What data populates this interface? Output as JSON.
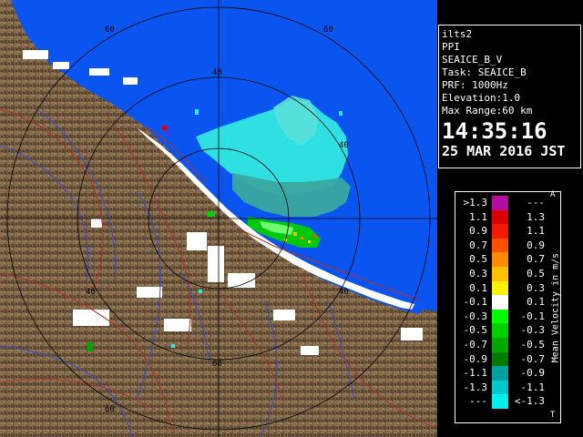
{
  "info": {
    "site": "ilts2",
    "mode": "PPI",
    "product": "SEAICE_B_V",
    "task": "Task: SEAICE_B",
    "prf": "PRF: 1000Hz",
    "elevation": "Elevation:1.0",
    "max_range": "Max Range:60 km",
    "time": "14:35:16",
    "date": "25 MAR 2016 JST"
  },
  "rings": {
    "labels": [
      "60",
      "40",
      "40",
      "40",
      "40",
      "60",
      "60",
      "60"
    ]
  },
  "legend": {
    "title": "Mean Velocity in m/s",
    "corner_top": "A",
    "corner_bottom": "T",
    "rows": [
      {
        "left": ">1.3",
        "right": "---",
        "color": "#b40ea0"
      },
      {
        "left": "1.1",
        "right": "1.3",
        "color": "#d90000"
      },
      {
        "left": "0.9",
        "right": "1.1",
        "color": "#f21a00"
      },
      {
        "left": "0.7",
        "right": "0.9",
        "color": "#ff5000"
      },
      {
        "left": "0.5",
        "right": "0.7",
        "color": "#ff8c00"
      },
      {
        "left": "0.3",
        "right": "0.5",
        "color": "#ffc000"
      },
      {
        "left": "0.1",
        "right": "0.3",
        "color": "#fff200"
      },
      {
        "left": "-0.1",
        "right": "0.1",
        "color": "#ffffff"
      },
      {
        "left": "-0.3",
        "right": "-0.1",
        "color": "#00ff00"
      },
      {
        "left": "-0.5",
        "right": "-0.3",
        "color": "#00d000"
      },
      {
        "left": "-0.7",
        "right": "-0.5",
        "color": "#00a800"
      },
      {
        "left": "-0.9",
        "right": "-0.7",
        "color": "#007a00"
      },
      {
        "left": "-1.1",
        "right": "-0.9",
        "color": "#00a0a0"
      },
      {
        "left": "-1.3",
        "right": "-1.1",
        "color": "#00c8c8"
      },
      {
        "left": "---",
        "right": "<-1.3",
        "color": "#00f0f0"
      }
    ]
  },
  "colors": {
    "sea": "#0a55f0",
    "land": "#7a6040",
    "ring": "#000000",
    "river": "#3a4cc8",
    "road": "#b03028",
    "coast_white": "#ffffff",
    "echo_cyan": "#30e8e0",
    "echo_teal": "#3aa8a0"
  }
}
